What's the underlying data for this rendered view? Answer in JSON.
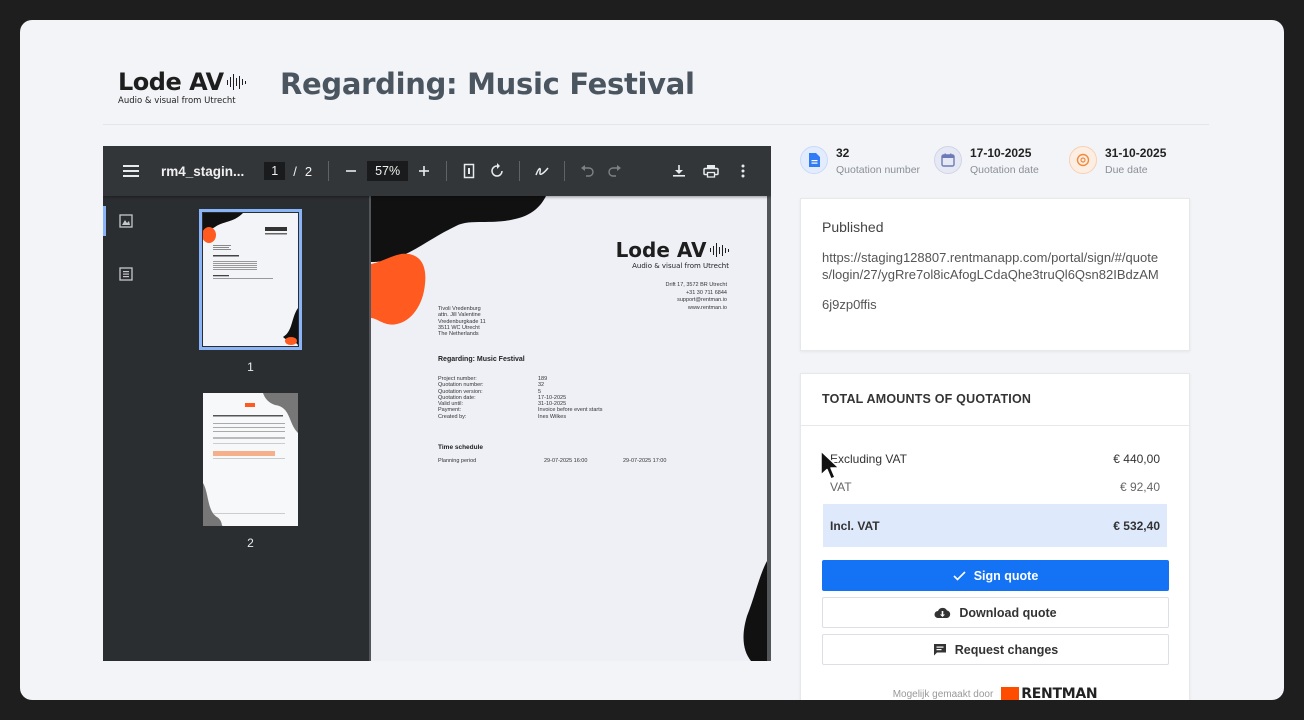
{
  "header": {
    "logo_text": "Lode AV",
    "logo_tagline": "Audio & visual from Utrecht",
    "title": "Regarding: Music Festival"
  },
  "viewer": {
    "filename": "rm4_stagin...",
    "current_page": "1",
    "page_separator": "/",
    "total_pages": "2",
    "zoom": "57%",
    "thumbnails": [
      {
        "label": "1"
      },
      {
        "label": "2"
      }
    ]
  },
  "document": {
    "logo_text": "Lode AV",
    "logo_tagline": "Audio & visual from Utrecht",
    "company_address": [
      "Drift 17, 3572 BR Utrecht",
      "+31 30 711 6844",
      "support@rentman.io",
      "www.rentman.io"
    ],
    "recipient": [
      "Tivoli Vredenburg",
      "attn. Jill Valentine",
      "Vredenburgkade 11",
      "3511 WC Utrecht",
      "The Netherlands"
    ],
    "heading": "Regarding: Music Festival",
    "details": [
      {
        "key": "Project number:",
        "value": "189"
      },
      {
        "key": "Quotation number:",
        "value": "32"
      },
      {
        "key": "Quotation version:",
        "value": "5"
      },
      {
        "key": "Quotation date:",
        "value": "17-10-2025"
      },
      {
        "key": "Valid until:",
        "value": "31-10-2025"
      },
      {
        "key": "Payment:",
        "value": "Invoice before event starts"
      },
      {
        "key": "Created by:",
        "value": "Ines Wilkes"
      }
    ],
    "time_schedule_heading": "Time schedule",
    "time_schedule": {
      "label": "Planning period",
      "start": "29-07-2025 16:00",
      "end": "29-07-2025 17:00"
    }
  },
  "meta": {
    "quotation_number": {
      "value": "32",
      "label": "Quotation number",
      "icon": "document-icon",
      "color": "#2f7cf6"
    },
    "quotation_date": {
      "value": "17-10-2025",
      "label": "Quotation date",
      "icon": "calendar-icon",
      "color": "#6b7bb8"
    },
    "due_date": {
      "value": "31-10-2025",
      "label": "Due date",
      "icon": "clock-icon",
      "color": "#f08a3c"
    }
  },
  "publication": {
    "status": "Published",
    "url": "https://staging128807.rentmanapp.com/portal/sign/#/quotes/login/27/ygRre7ol8icAfogLCdaQhe3truQl6Qsn82IBdzAM",
    "code": "6j9zp0ffis"
  },
  "totals": {
    "heading": "TOTAL AMOUNTS OF QUOTATION",
    "excl_label": "Excluding VAT",
    "excl_value": "€ 440,00",
    "vat_label": "VAT",
    "vat_value": "€ 92,40",
    "incl_label": "Incl. VAT",
    "incl_value": "€ 532,40"
  },
  "actions": {
    "sign": "Sign quote",
    "download": "Download quote",
    "request": "Request changes"
  },
  "footer": {
    "powered_by": "Mogelijk gemaakt door",
    "brand": "RENTMAN"
  },
  "colors": {
    "primary": "#1473f5",
    "accent_orange": "#ff5a1f",
    "highlight": "#deeafb"
  }
}
